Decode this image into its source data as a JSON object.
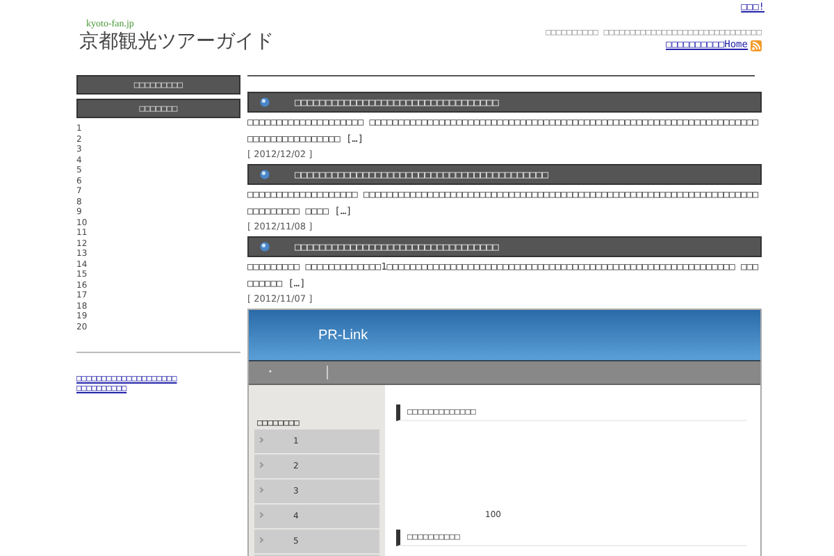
{
  "top_link": "□□□!",
  "logo": {
    "domain": "kyoto-fan.jp",
    "title": "京都観光ツアーガイド"
  },
  "tagline": "□□□□□□□□□□ □□□□□□□□□□□□□□□□□□□□□□□□□□□□□□",
  "home_link": "□□□□□□□□□□Home",
  "sidebar": {
    "headings": [
      "□□□□□□□□□",
      "□□□□□□□"
    ],
    "numbers": [
      "1",
      "2",
      "3",
      "4",
      "5",
      "6",
      "7",
      "8",
      "9",
      "10",
      "11",
      "12",
      "13",
      "14",
      "15",
      "16",
      "17",
      "18",
      "19",
      "20"
    ],
    "links": [
      "□□□□□□□□□□□□□□□□□□□□",
      "□□□□□□□□□□"
    ]
  },
  "posts": [
    {
      "title": "□□□□□□□□□□□□□□□□□□□□□□□□□□□□□□□□□",
      "excerpt": "□□□□□□□□□□□□□□□□□□□□ □□□□□□□□□□□□□□□□□□□□□□□□□□□□□□□□□□□□□□□□□□□□□□□□□□□□□□□□□□□□□□□□□□□□□□□□□□□□□□□□□□□ […]",
      "date": "[ 2012/12/02 ]"
    },
    {
      "title": "□□□□□□□□□□□□□□□□□□□□□□□□□□□□□□□□□□□□□□□□□",
      "excerpt": "□□□□□□□□□□□□□□□□□□□ □□□□□□□□□□□□□□□□□□□□□□□□□□□□□□□□□□□□□□□□□□□□□□□□□□□□□□□□□□□□□□□□□□□□□□□□□□□□□ □□□□ […]",
      "date": "[ 2012/11/08 ]"
    },
    {
      "title": "□□□□□□□□□□□□□□□□□□□□□□□□□□□□□□□□□",
      "excerpt": "□□□□□□□□□ □□□□□□□□□□□□□1□□□□□□□□□□□□□□□□□□□□□□□□□□□□□□□□□□□□□□□□□□□□□□□□□□□□□□□□□□□□ □□□□□□□□□ […]",
      "date": "[ 2012/11/07 ]"
    }
  ],
  "embed": {
    "title": "PR-Link",
    "nav_bullet": "•",
    "menu_title": "□□□□□□□□",
    "menu_items": [
      "1",
      "2",
      "3",
      "4",
      "5"
    ],
    "headings": [
      "□□□□□□□□□□□□□",
      "□□□□□□□□□□"
    ],
    "number": "100"
  }
}
